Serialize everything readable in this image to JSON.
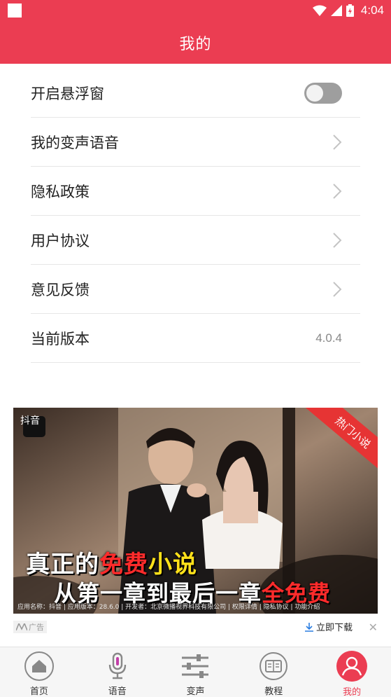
{
  "status_bar": {
    "time": "4:04"
  },
  "header": {
    "title": "我的"
  },
  "settings": {
    "floating_window": {
      "label": "开启悬浮窗",
      "enabled": false
    },
    "my_voice": {
      "label": "我的变声语音"
    },
    "privacy_policy": {
      "label": "隐私政策"
    },
    "user_agreement": {
      "label": "用户协议"
    },
    "feedback": {
      "label": "意见反馈"
    },
    "version": {
      "label": "当前版本",
      "value": "4.0.4"
    }
  },
  "ad": {
    "brand": "抖音",
    "ribbon": "热门小说",
    "headline": {
      "part1": "真正的",
      "part2": "免费",
      "part3": "小说"
    },
    "subline": {
      "part1": "从第一章到最后一章",
      "part2": "全免费"
    },
    "info": "应用名称：抖音 | 应用版本：28.6.0 | 开发者：北京微播视界科技有限公司 | 权限详情 | 隐私协议 | 功能介绍",
    "tag": "广告",
    "download": "立即下载"
  },
  "bottom_nav": {
    "items": [
      {
        "label": "首页",
        "icon": "home-icon"
      },
      {
        "label": "语音",
        "icon": "microphone-icon"
      },
      {
        "label": "变声",
        "icon": "sliders-icon"
      },
      {
        "label": "教程",
        "icon": "tutorial-icon"
      },
      {
        "label": "我的",
        "icon": "user-icon"
      }
    ],
    "active": 4
  },
  "colors": {
    "brand_red": "#eb3d52",
    "toggle_off": "#9e9e9e"
  }
}
